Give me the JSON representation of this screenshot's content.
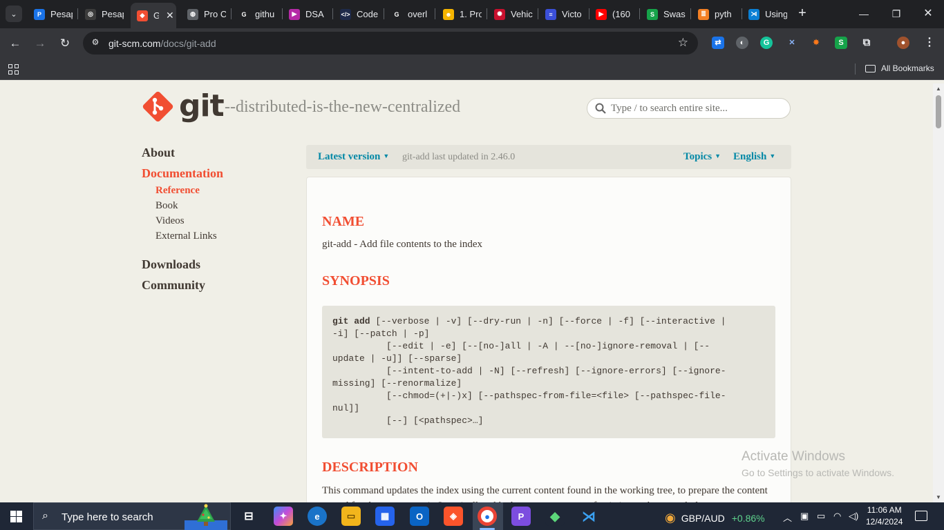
{
  "browser": {
    "tabs": [
      {
        "title": "Pesap",
        "icon": "pesapal-icon",
        "color": "#1a73e8",
        "glyph": "P"
      },
      {
        "title": "Pesap",
        "icon": "chatgpt-icon",
        "color": "#3c3c3c",
        "glyph": "◎"
      },
      {
        "title": "G",
        "icon": "git-icon",
        "color": "#f14e32",
        "glyph": "◆",
        "active": true
      },
      {
        "title": "Pro C",
        "icon": "globe-icon",
        "color": "#5f6368",
        "glyph": "◍"
      },
      {
        "title": "githu",
        "icon": "google-icon",
        "color": "#202124",
        "glyph": "G"
      },
      {
        "title": "DSA",
        "icon": "play-icon",
        "color": "#b52aa6",
        "glyph": "▶"
      },
      {
        "title": "Code",
        "icon": "code-icon",
        "color": "#1e2a4a",
        "glyph": "</>"
      },
      {
        "title": "overl",
        "icon": "google-icon",
        "color": "#202124",
        "glyph": "G"
      },
      {
        "title": "1. Pro",
        "icon": "leetcode-icon",
        "color": "#f5b400",
        "glyph": "☻"
      },
      {
        "title": "Vehic",
        "icon": "spark-icon",
        "color": "#c8102e",
        "glyph": "✺"
      },
      {
        "title": "Victo",
        "icon": "list-icon",
        "color": "#3b4fd8",
        "glyph": "≡"
      },
      {
        "title": "(160",
        "icon": "youtube-icon",
        "color": "#ff0000",
        "glyph": "▶"
      },
      {
        "title": "Swas",
        "icon": "swahili-icon",
        "color": "#16a34a",
        "glyph": "S"
      },
      {
        "title": "pyth",
        "icon": "stackoverflow-icon",
        "color": "#f48024",
        "glyph": "≣"
      },
      {
        "title": "Using",
        "icon": "vscode-icon",
        "color": "#0a7fd4",
        "glyph": "⋊"
      }
    ],
    "close_tab": "✕",
    "new_tab": "+",
    "url_host": "git-scm.com",
    "url_path": "/docs/git-add",
    "all_bookmarks": "All Bookmarks"
  },
  "site": {
    "logo_text": "git",
    "tagline": "--distributed-is-the-new-centralized",
    "search_placeholder": "Type / to search entire site...",
    "nav": {
      "about": "About",
      "documentation": "Documentation",
      "reference": "Reference",
      "book": "Book",
      "videos": "Videos",
      "external_links": "External Links",
      "downloads": "Downloads",
      "community": "Community"
    },
    "version_bar": {
      "latest": "Latest version",
      "updated": "git-add last updated in 2.46.0",
      "topics": "Topics",
      "language": "English"
    },
    "doc": {
      "name_heading": "NAME",
      "name_text": "git-add - Add file contents to the index",
      "synopsis_heading": "SYNOPSIS",
      "synopsis_cmd": "git add",
      "synopsis_lines": [
        " [--verbose | -v] [--dry-run | -n] [--force | -f] [--interactive |",
        "-i] [--patch | -p]",
        "          [--edit | -e] [--[no-]all | -A | --[no-]ignore-removal | [--",
        "update | -u]] [--sparse]",
        "          [--intent-to-add | -N] [--refresh] [--ignore-errors] [--ignore-",
        "missing] [--renormalize]",
        "          [--chmod=(+|-)x] [--pathspec-from-file=<file> [--pathspec-file-",
        "nul]]",
        "          [--] [<pathspec>…​]"
      ],
      "description_heading": "DESCRIPTION",
      "description_text": "This command updates the index using the current content found in the working tree, to prepare the content staged for the next commit. It typically adds the current content of existing paths as a whole,"
    },
    "watermark_title": "Activate Windows",
    "watermark_sub": "Go to Settings to activate Windows."
  },
  "taskbar": {
    "search_placeholder": "Type here to search",
    "ticker_symbol": "GBP/AUD",
    "ticker_change": "+0.86%",
    "time": "11:06 AM",
    "date": "12/4/2024"
  },
  "colors": {
    "git_orange": "#f14e32",
    "link_teal": "#0388a6",
    "text_dark": "#413932",
    "page_bg": "#f0efe7"
  }
}
